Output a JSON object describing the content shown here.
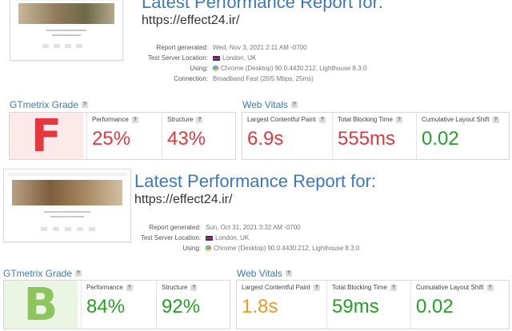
{
  "colors": {
    "red": "#e5373e",
    "green": "#23a123",
    "orange": "#e89b1f",
    "blue": "#3a78c2",
    "grade_f_bg": "#fde9ea",
    "grade_b_bg": "#eaf5e4",
    "grade_b": "#8dc45c"
  },
  "reports": [
    {
      "title": "Latest Performance Report for:",
      "url": "https://effect24.ir/",
      "meta": [
        {
          "key": "Report generated:",
          "value": "Wed, Nov 3, 2021 2:11 AM -0700",
          "icon": ""
        },
        {
          "key": "Test Server Location:",
          "value": "London, UK",
          "icon": "uk-flag-icon"
        },
        {
          "key": "Using:",
          "value": "Chrome (Desktop) 90.0.4430.212, Lighthouse 8.3.0",
          "icon": "chrome-icon"
        },
        {
          "key": "Connection:",
          "value": "Broadband Fast (20/5 Mbps, 25ms)",
          "icon": ""
        }
      ],
      "grade_label": "GTmetrix Grade",
      "vitals_label": "Web Vitals",
      "help": "?",
      "grade": "F",
      "performance_label": "Performance",
      "performance": "25%",
      "structure_label": "Structure",
      "structure": "43%",
      "lcp_label": "Largest Contentful Paint",
      "lcp": "6.9s",
      "tbt_label": "Total Blocking Time",
      "tbt": "555ms",
      "cls_label": "Cumulative Layout Shift",
      "cls": "0.02"
    },
    {
      "title": "Latest Performance Report for:",
      "url": "https://effect24.ir/",
      "meta": [
        {
          "key": "Report generated:",
          "value": "Sun, Oct 31, 2021 3:32 AM -0700",
          "icon": ""
        },
        {
          "key": "Test Server Location:",
          "value": "London, UK",
          "icon": "uk-flag-icon"
        },
        {
          "key": "Using:",
          "value": "Chrome (Desktop) 90.0.4430.212, Lighthouse 8.3.0",
          "icon": "chrome-icon"
        }
      ],
      "grade_label": "GTmetrix Grade",
      "vitals_label": "Web Vitals",
      "help": "?",
      "grade": "B",
      "performance_label": "Performance",
      "performance": "84%",
      "structure_label": "Structure",
      "structure": "92%",
      "lcp_label": "Largest Contentful Paint",
      "lcp": "1.8s",
      "tbt_label": "Total Blocking Time",
      "tbt": "59ms",
      "cls_label": "Cumulative Layout Shift",
      "cls": "0.02"
    }
  ]
}
